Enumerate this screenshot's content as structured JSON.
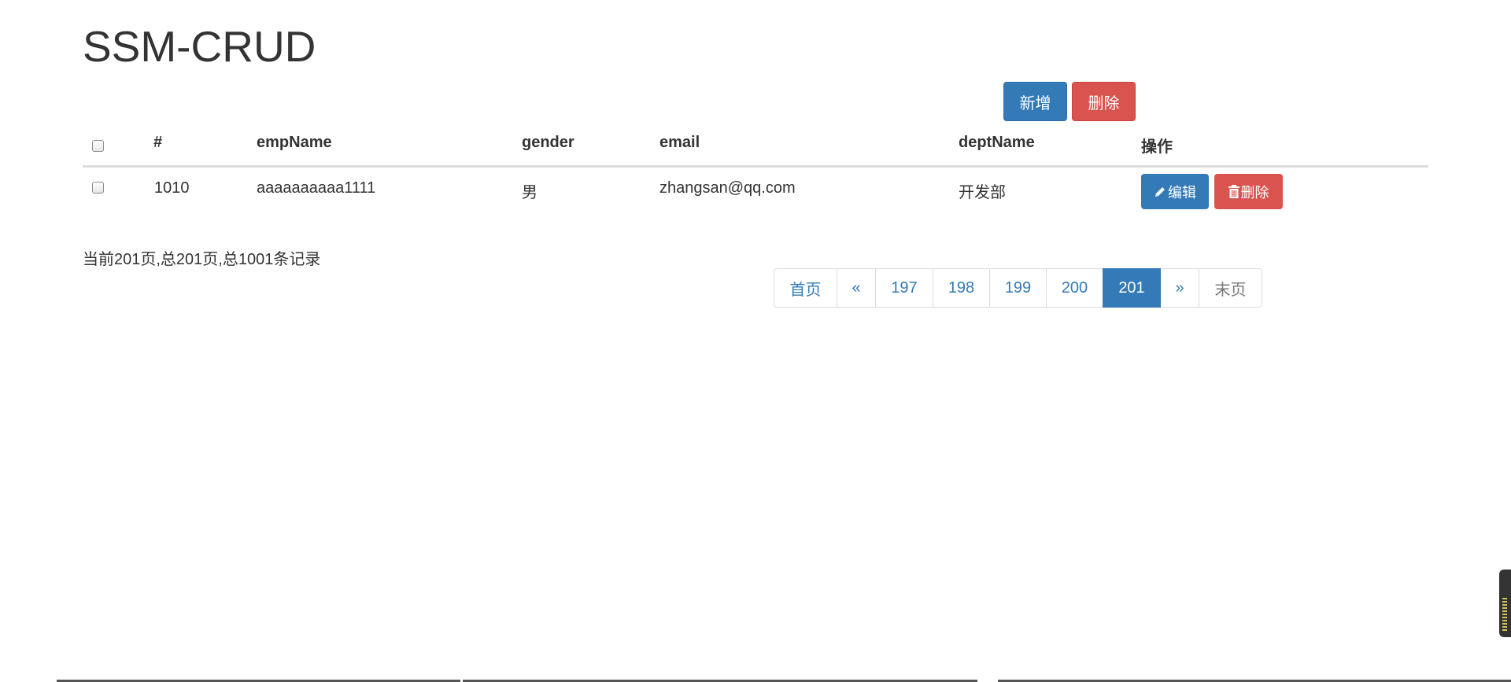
{
  "page_title": "SSM-CRUD",
  "toolbar": {
    "add_label": "新增",
    "delete_label": "删除"
  },
  "table": {
    "headers": {
      "id": "#",
      "emp_name": "empName",
      "gender": "gender",
      "email": "email",
      "dept_name": "deptName",
      "actions": "操作"
    },
    "rows": [
      {
        "id": "1010",
        "emp_name": "aaaaaaaaaa1111",
        "gender": "男",
        "email": "zhangsan@qq.com",
        "dept_name": "开发部",
        "edit_label": "编辑",
        "delete_label": "删除"
      }
    ]
  },
  "page_info": "当前201页,总201页,总1001条记录",
  "pagination": {
    "first": "首页",
    "prev": "«",
    "pages": [
      "197",
      "198",
      "199",
      "200",
      "201"
    ],
    "active_page": "201",
    "next": "»",
    "last": "末页"
  },
  "colors": {
    "primary": "#337ab7",
    "danger": "#d9534f",
    "text": "#333333"
  },
  "icons": {
    "edit": "pencil-icon",
    "delete": "trash-icon"
  }
}
